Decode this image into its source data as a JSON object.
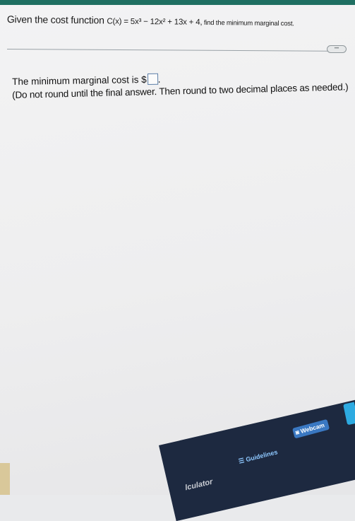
{
  "question": {
    "prefix": "Given the cost function ",
    "math": "C(x) = 5x³ − 12x² + 13x + 4,",
    "tail": " find the minimum marginal cost."
  },
  "more_button": {
    "label": "•••"
  },
  "answer": {
    "prefix": "The minimum marginal cost is $",
    "suffix": "."
  },
  "instruction": {
    "main": "(Do not round until the final answer. Then round to two decimal places as needed.)"
  },
  "toolbar": {
    "calculator": "lculator",
    "guidelines": "Guidelines",
    "webcam": "Webcam"
  }
}
